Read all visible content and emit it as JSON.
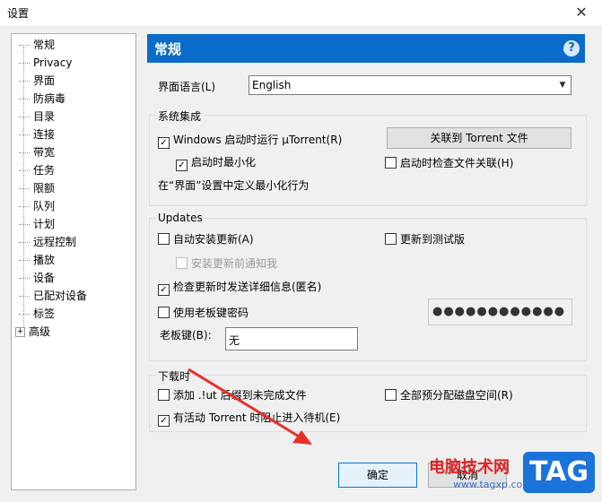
{
  "window": {
    "title": "设置",
    "close": "✕"
  },
  "sidebar": {
    "items": [
      {
        "label": "常规"
      },
      {
        "label": "Privacy"
      },
      {
        "label": "界面"
      },
      {
        "label": "防病毒"
      },
      {
        "label": "目录"
      },
      {
        "label": "连接"
      },
      {
        "label": "带宽"
      },
      {
        "label": "任务"
      },
      {
        "label": "限额"
      },
      {
        "label": "队列"
      },
      {
        "label": "计划"
      },
      {
        "label": "远程控制"
      },
      {
        "label": "播放"
      },
      {
        "label": "设备"
      },
      {
        "label": "已配对设备"
      },
      {
        "label": "标签"
      },
      {
        "label": "高级",
        "expander": "+"
      }
    ]
  },
  "header": {
    "title": "常规",
    "help": "?"
  },
  "language": {
    "label": "界面语言(L)",
    "value": "English"
  },
  "system": {
    "title": "系统集成",
    "run_on_start": {
      "label": "Windows 启动时运行 µTorrent(R)",
      "checked": true,
      "mark": "✓"
    },
    "associate_btn": "关联到 Torrent 文件",
    "minimized": {
      "label": "启动时最小化",
      "checked": true,
      "mark": "✓"
    },
    "check_assoc": {
      "label": "启动时检查文件关联(H)",
      "checked": false
    },
    "note": "在“界面”设置中定义最小化行为"
  },
  "updates": {
    "title": "Updates",
    "auto_install": {
      "label": "自动安装更新(A)",
      "checked": false
    },
    "beta": {
      "label": "更新到测试版",
      "checked": false
    },
    "notify": {
      "label": "安装更新前通知我",
      "checked": false
    },
    "send_info": {
      "label": "检查更新时发送详细信息(匿名)",
      "checked": true,
      "mark": "✓"
    },
    "boss_pwd": {
      "label": "使用老板键密码",
      "checked": false
    },
    "password_mask": "●●●●●●●●●●●●",
    "boss_key_label": "老板键(B):",
    "boss_key_value": "无"
  },
  "download": {
    "title": "下载时",
    "append_ut": {
      "label": "添加 .!ut 后缀到未完成文件",
      "checked": false
    },
    "prealloc": {
      "label": "全部预分配磁盘空间(R)",
      "checked": false
    },
    "prevent_standby": {
      "label": "有活动 Torrent 时阻止进入待机(E)",
      "checked": true,
      "mark": "✓"
    }
  },
  "footer": {
    "ok": "确定",
    "cancel": "取消"
  },
  "watermark": {
    "text": "电脑技术网",
    "url": "www.tagxp.com",
    "logo": "TAG"
  },
  "colors": {
    "header": "#0b6bc8",
    "arrow": "#e8302a"
  }
}
